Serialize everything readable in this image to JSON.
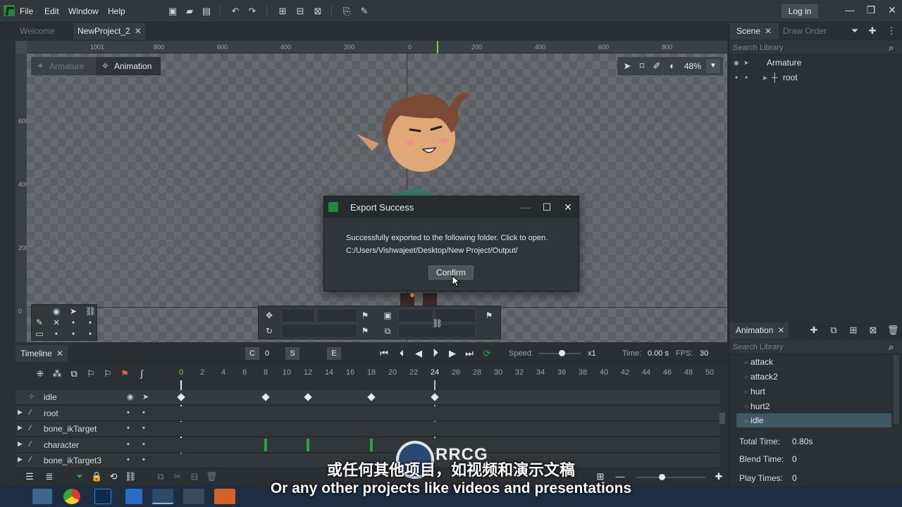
{
  "menu": {
    "items": [
      "File",
      "Edit",
      "Window",
      "Help"
    ],
    "login": "Log in"
  },
  "tabs": {
    "welcome": "Welcome",
    "project": "NewProject_2",
    "close": "✕"
  },
  "ruler": {
    "labels": [
      "1001",
      "800",
      "600",
      "400",
      "200",
      "0",
      "200",
      "400",
      "600",
      "800"
    ],
    "vlabels": [
      "600",
      "400",
      "200",
      "0"
    ]
  },
  "canvas": {
    "modes": {
      "armature": "Armature",
      "animation": "Animation"
    },
    "zoom": "48%"
  },
  "dialog": {
    "title": "Export Success",
    "message": "Successfully exported to the following folder. Click to open.",
    "path": "C:/Users/Vishwajeet/Desktop/New Project/Output/",
    "confirm": "Confirm"
  },
  "scene": {
    "tabs": {
      "scene": "Scene",
      "draw_order": "Draw Order"
    },
    "search_placeholder": "Search Library",
    "tree": {
      "armature": "Armature",
      "root": "root"
    }
  },
  "animation_panel": {
    "title": "Animation",
    "search_placeholder": "Search Library",
    "items": [
      "attack",
      "attack2",
      "hurt",
      "hurt2",
      "idle"
    ],
    "selected": "idle",
    "props": {
      "total_time_label": "Total Time:",
      "total_time": "0.80s",
      "blend_time_label": "Blend Time:",
      "blend_time": "0",
      "play_times_label": "Play Times:",
      "play_times": "0"
    }
  },
  "timeline": {
    "title": "Timeline",
    "c_label": "C",
    "c_value": "0",
    "s_label": "S",
    "e_label": "E",
    "speed_label": "Speed:",
    "speed_value": "x1",
    "speed_level": 0.55,
    "time_label": "Time:",
    "time_value": "0.00 s",
    "fps_label": "FPS:",
    "fps_value": "30",
    "frames": [
      "0",
      "2",
      "4",
      "6",
      "8",
      "10",
      "12",
      "14",
      "16",
      "18",
      "20",
      "22",
      "24",
      "26",
      "28",
      "30",
      "32",
      "34",
      "36",
      "38",
      "40",
      "42",
      "44",
      "46",
      "48",
      "50"
    ],
    "tracks": [
      {
        "name": "idle"
      },
      {
        "name": "root"
      },
      {
        "name": "bone_ikTarget"
      },
      {
        "name": "character"
      },
      {
        "name": "bone_ikTarget3"
      }
    ],
    "idle_keys": [
      0,
      8,
      12,
      18,
      24
    ],
    "character_keys": [
      8,
      12,
      18
    ]
  },
  "subtitles": {
    "cn": "或任何其他项目，如视频和演示文稿",
    "en": "Or any other projects like videos and presentations"
  },
  "watermark": "RRCG",
  "colors": {
    "accent_green": "#24a43c",
    "selection": "#3f5866",
    "taskbar": "#1d2e42"
  }
}
